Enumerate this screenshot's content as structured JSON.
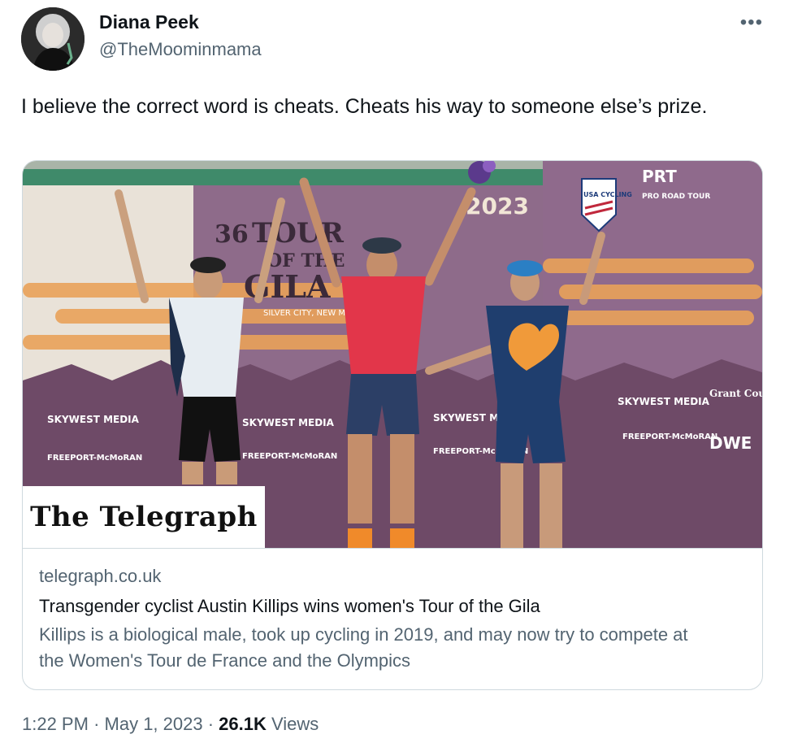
{
  "author": {
    "name": "Diana Peek",
    "handle": "@TheMoominmama"
  },
  "tweet": {
    "text": "I believe the correct word is cheats. Cheats his way to someone else’s prize."
  },
  "card": {
    "image_source_logo": "The Telegraph",
    "banner": {
      "year": "2023",
      "usa_cycling": "USA CYCLING",
      "prt": "PRT",
      "pro_road_tour": "PRO ROAD TOUR",
      "tour_line1": "36",
      "tour_line2": "TOUR",
      "tour_line3": "OF THE",
      "tour_line4": "GILA",
      "silver_city": "SILVER CITY, NEW MEXICO",
      "sponsor1": "SKYWEST MEDIA",
      "sponsor2": "FREEPORT-McMoRAN",
      "sponsor3": "Grant County",
      "sponsor4": "DWE"
    },
    "domain": "telegraph.co.uk",
    "headline": "Transgender cyclist Austin Killips wins women's Tour of the Gila",
    "description": "Killips is a biological male, took up cycling in 2019, and may now try to compete at the Women's Tour de France and the Olympics"
  },
  "meta": {
    "time": "1:22 PM",
    "separator": "·",
    "date": "May 1, 2023",
    "views_count": "26.1K",
    "views_label": "Views"
  },
  "icons": {
    "more": "more-icon"
  },
  "colors": {
    "text": "#0f1419",
    "secondary": "#536471",
    "border": "#cfd9de"
  }
}
